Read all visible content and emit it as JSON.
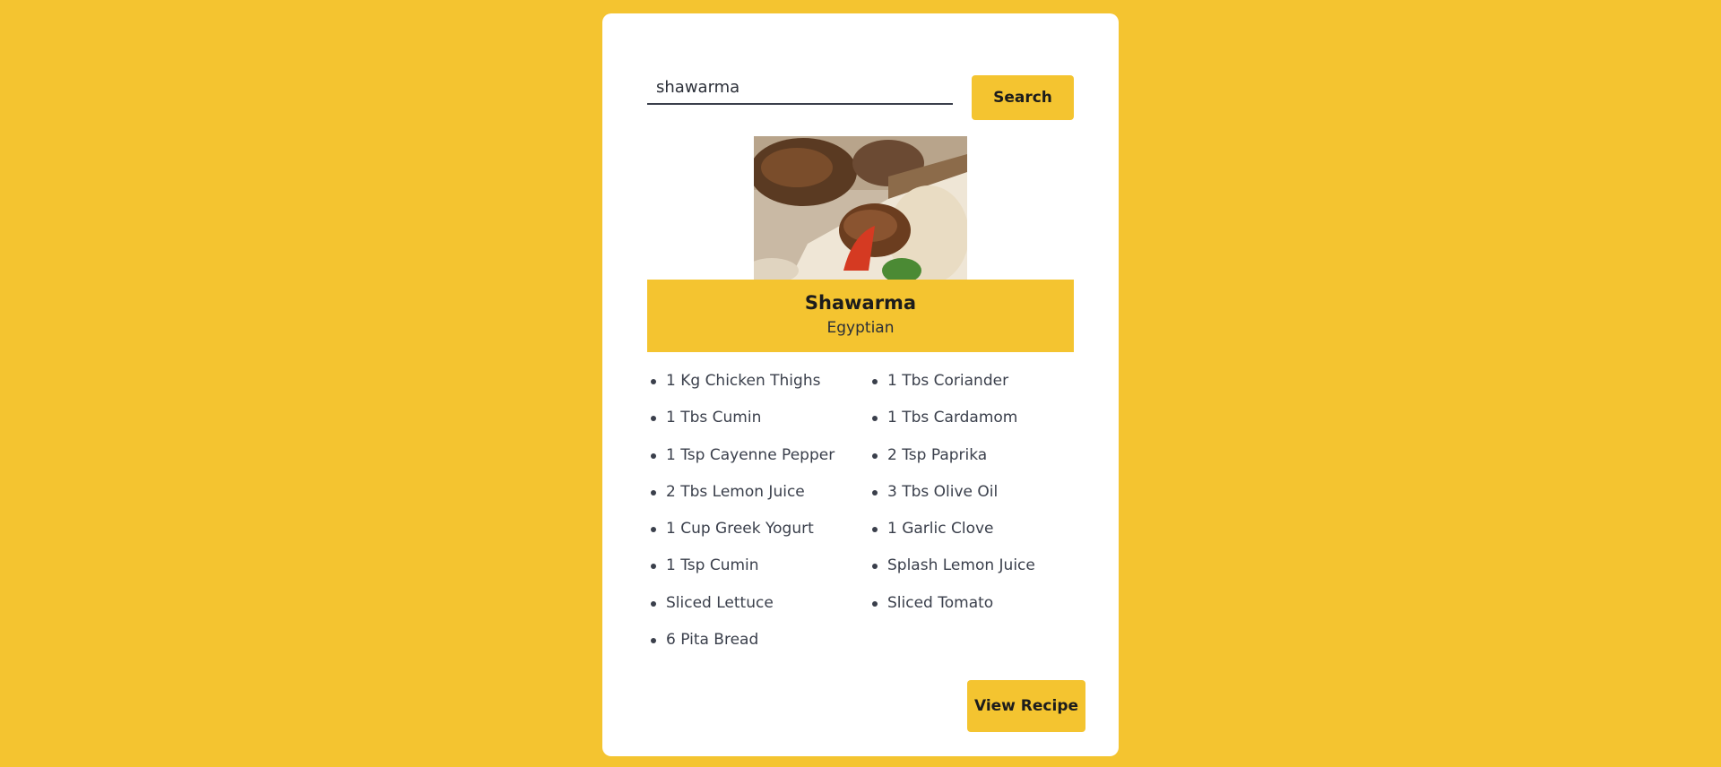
{
  "search": {
    "value": "shawarma",
    "button_label": "Search"
  },
  "meal": {
    "image": "shawarma-photo",
    "title": "Shawarma",
    "area": "Egyptian",
    "ingredients": [
      "1 Kg Chicken Thighs",
      "1 Tbs Coriander",
      "1 Tbs Cumin",
      "1 Tbs Cardamom",
      "1 Tsp Cayenne Pepper",
      "2 Tsp Paprika",
      "2 Tbs Lemon Juice",
      "3 Tbs Olive Oil",
      "1 Cup Greek Yogurt",
      "1 Garlic Clove",
      "1 Tsp Cumin",
      "Splash Lemon Juice",
      "Sliced Lettuce",
      "Sliced Tomato",
      "6 Pita Bread"
    ],
    "view_recipe_label": "View Recipe"
  },
  "colors": {
    "background": "#F4C430",
    "card": "#ffffff",
    "accent": "#F4C430",
    "text": "#3a3f4b"
  }
}
